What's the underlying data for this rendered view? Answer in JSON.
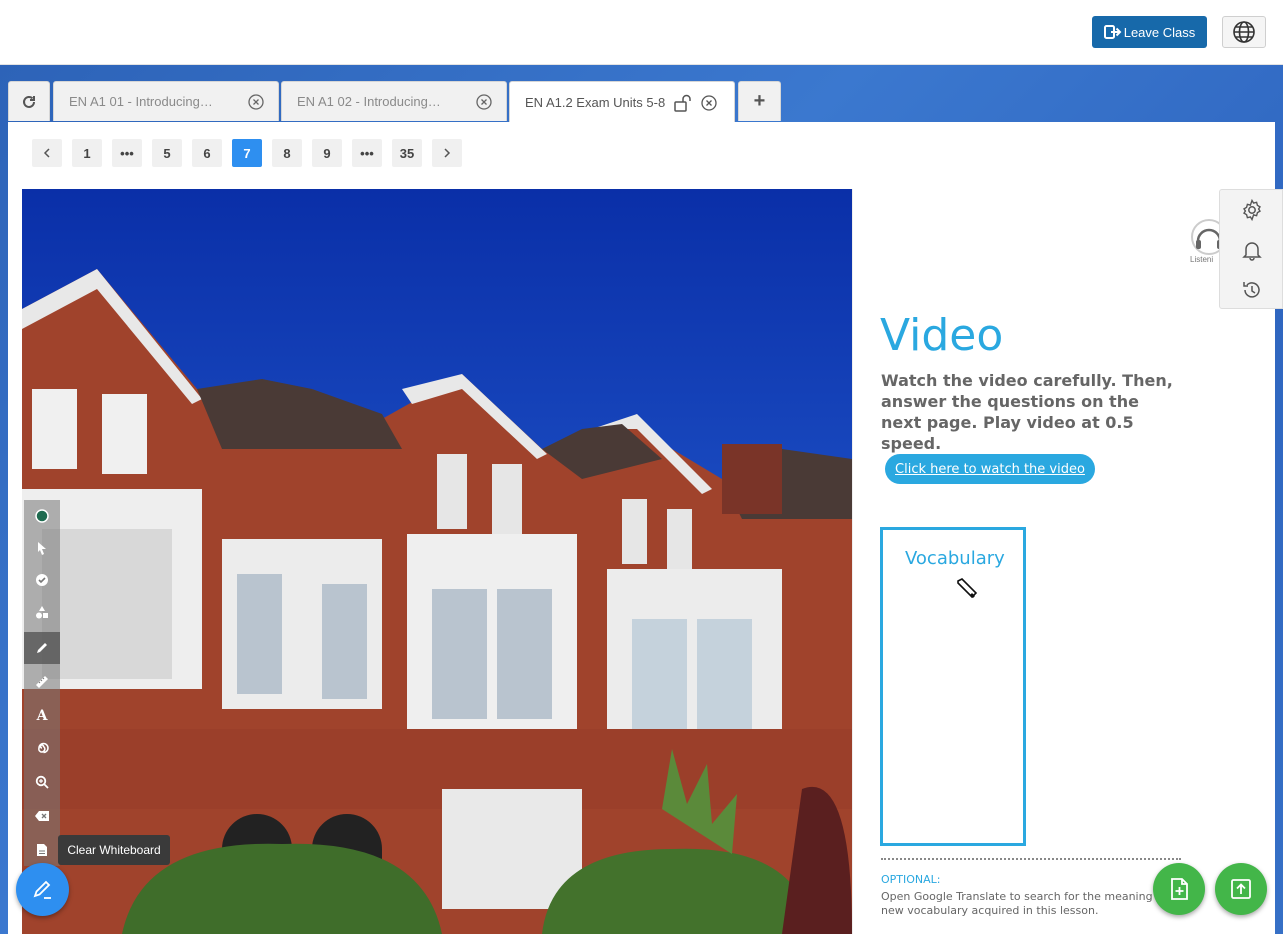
{
  "header": {
    "leave_class_label": "Leave Class",
    "accent_color": "#1769aa"
  },
  "tabs": [
    {
      "label": "EN A1 01 - Introducing…",
      "active": false
    },
    {
      "label": "EN A1 02 - Introducing…",
      "active": false
    },
    {
      "label": "EN A1.2 Exam Units 5-8",
      "active": true
    }
  ],
  "tab_add_label": "+",
  "pagination": {
    "items": [
      "1",
      "•••",
      "5",
      "6",
      "7",
      "8",
      "9",
      "•••",
      "35"
    ],
    "current": "7"
  },
  "slide": {
    "title": "Video",
    "description": "Watch the video carefully. Then, answer the questions on the next page. Play video at 0.5 speed.",
    "watch_link": "Click here to watch the video",
    "vocabulary_label": "Vocabulary",
    "listening_label": "Listeni",
    "optional_heading": "OPTIONAL:",
    "optional_line1": "Open Google Translate to search for the meaning",
    "optional_line2": "new vocabulary acquired in this lesson.",
    "accent_color": "#2aa8e0"
  },
  "toolbar": {
    "tooltip": "Clear Whiteboard",
    "text_tool_glyph": "A",
    "tools": [
      "color-dot",
      "pointer",
      "check",
      "shapes",
      "pen",
      "ruler",
      "text",
      "laser",
      "zoom",
      "eraser",
      "clear-whiteboard"
    ]
  },
  "side_tools": [
    "gear-icon",
    "bell-icon",
    "history-icon"
  ]
}
